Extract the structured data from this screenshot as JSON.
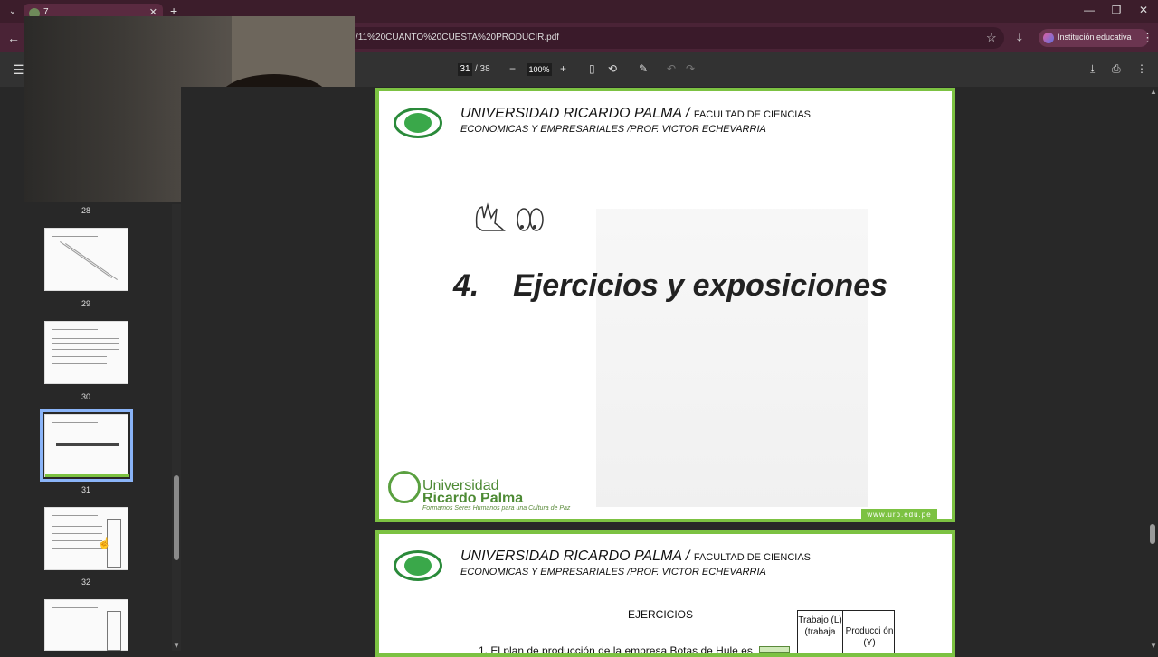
{
  "browser": {
    "tab_title": "7",
    "url": "/11%20CUANTO%20CUESTA%20PRODUCIR.pdf",
    "profile_label": "Institución educativa"
  },
  "pdf_toolbar": {
    "current_page": "31",
    "total_pages": "/ 38",
    "zoom": "100%"
  },
  "sidebar": {
    "thumbnails": [
      {
        "page": "28"
      },
      {
        "page": "29"
      },
      {
        "page": "30"
      },
      {
        "page": "31",
        "selected": true
      },
      {
        "page": "32"
      }
    ]
  },
  "slide31": {
    "header_main": "UNIVERSIDAD RICARDO PALMA /",
    "header_faculty": "FACULTAD DE CIENCIAS",
    "header_sub": "ECONOMICAS Y EMPRESARIALES /PROF. VICTOR ECHEVARRIA",
    "title": "4.    Ejercicios y exposiciones",
    "uni_name_1": "Universidad",
    "uni_name_2": "Ricardo Palma",
    "motto": "Formamos Seres Humanos para una Cultura de Paz",
    "website": "www.urp.edu.pe"
  },
  "slide32": {
    "header_main": "UNIVERSIDAD RICARDO PALMA /",
    "header_faculty": "FACULTAD DE CIENCIAS",
    "header_sub": "ECONOMICAS Y EMPRESARIALES /PROF. VICTOR ECHEVARRIA",
    "section": "EJERCICIOS",
    "item1": "1. El plan de producción de la empresa Botas de Hule es",
    "table_col1": "Trabajo (L) (trabaja",
    "table_col2": "Producci ón (Y)"
  },
  "colors": {
    "accent_green": "#7cc242",
    "titlebar": "#3c1d2b",
    "pdf_toolbar": "#323232"
  }
}
